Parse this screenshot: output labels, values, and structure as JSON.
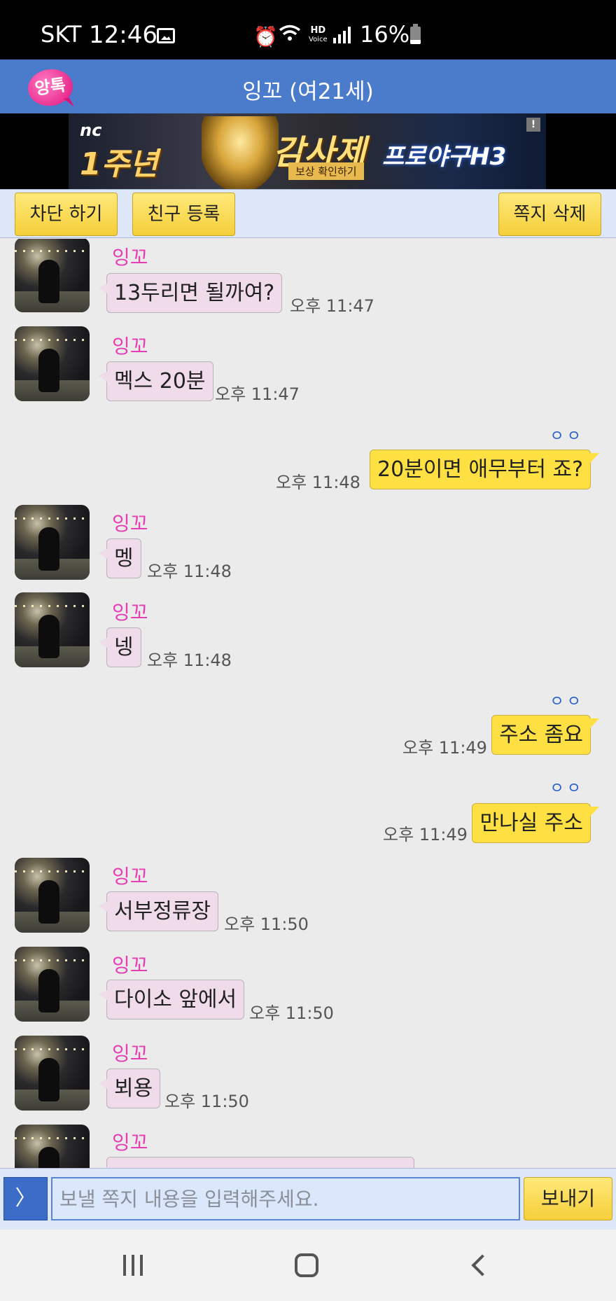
{
  "status_bar": {
    "carrier": "SKT",
    "time": "12:46",
    "hd_label": "HD",
    "voice_label": "Voice",
    "battery": "16%"
  },
  "header": {
    "logo_text": "앙톡",
    "title": "잉꼬 (여21세)"
  },
  "ad": {
    "brand": "nc",
    "headline": "1주년",
    "event": "감사제",
    "sub": "보상 확인하기",
    "game": "프로야구H3",
    "info_badge": "!"
  },
  "toolbar": {
    "block_label": "차단 하기",
    "add_friend_label": "친구 등록",
    "delete_label": "쪽지 삭제"
  },
  "messages": [
    {
      "dir": "in",
      "sender": "잉꼬",
      "text": "13두리면 될까여?",
      "time": "오후 11:47"
    },
    {
      "dir": "in",
      "sender": "잉꼬",
      "text": "멕스 20분",
      "time": "오후 11:47"
    },
    {
      "dir": "out",
      "read": "ㅇㅇ",
      "text": "20분이면 애무부터 죠?",
      "time": "오후 11:48"
    },
    {
      "dir": "in",
      "sender": "잉꼬",
      "text": "멩",
      "time": "오후 11:48"
    },
    {
      "dir": "in",
      "sender": "잉꼬",
      "text": "넹",
      "time": "오후 11:48"
    },
    {
      "dir": "out",
      "read": "ㅇㅇ",
      "text": "주소 좀요",
      "time": "오후 11:49"
    },
    {
      "dir": "out",
      "read": "ㅇㅇ",
      "text": "만나실 주소",
      "time": "오후 11:49"
    },
    {
      "dir": "in",
      "sender": "잉꼬",
      "text": "서부정류장",
      "time": "오후 11:50"
    },
    {
      "dir": "in",
      "sender": "잉꼬",
      "text": "다이소 앞에서",
      "time": "오후 11:50"
    },
    {
      "dir": "in",
      "sender": "잉꼬",
      "text": "뵈용",
      "time": "오후 11:50"
    },
    {
      "dir": "in",
      "sender": "잉꼬",
      "text": "",
      "time": ""
    }
  ],
  "input": {
    "expand_icon": "〉",
    "placeholder": "보낼 쪽지 내용을 입력해주세요.",
    "send_label": "보내기"
  },
  "icons": {
    "status": [
      "image-icon",
      "alarm-icon",
      "wifi-icon",
      "signal-icon",
      "battery-icon"
    ],
    "nav": [
      "recents-icon",
      "home-icon",
      "back-icon"
    ]
  },
  "colors": {
    "header_blue": "#4a7ccb",
    "incoming_bubble": "#efdbe9",
    "outgoing_bubble": "#fee042",
    "sender_pink": "#e63fb4",
    "button_yellow": "#f5cf3a"
  }
}
